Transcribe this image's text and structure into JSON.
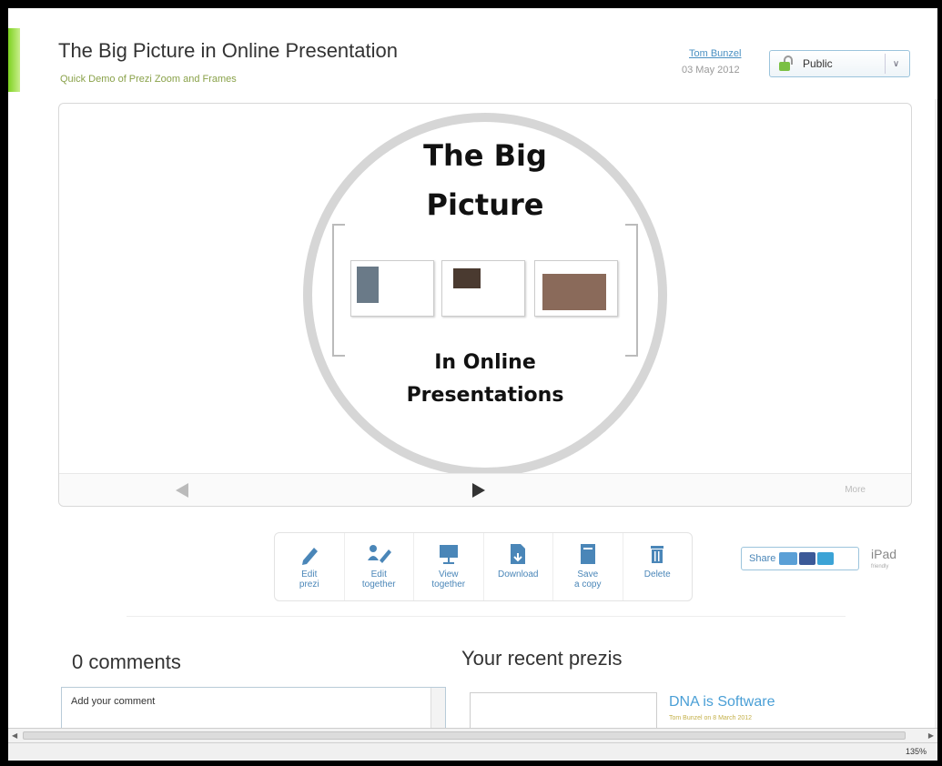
{
  "prezi": {
    "title": "The Big Picture in Online Presentation",
    "subtitle": "Quick Demo of Prezi Zoom and Frames",
    "author": "Tom Bunzel",
    "date": "03 May 2012",
    "privacy": "Public"
  },
  "canvas": {
    "title_line1": "The Big",
    "title_line2": "Picture",
    "sub_line1": "In Online",
    "sub_line2": "Presentations",
    "more_label": "More"
  },
  "toolbar": {
    "edit_prezi": "Edit\nprezi",
    "edit_together": "Edit\ntogether",
    "view_together": "View\ntogether",
    "download": "Download",
    "save_copy": "Save\na copy",
    "delete": "Delete"
  },
  "share": {
    "label": "Share",
    "ipad": "iPad",
    "ipad_sub": "friendly"
  },
  "comments": {
    "heading": "0 comments",
    "placeholder": "Add your comment"
  },
  "recent": {
    "heading": "Your recent prezis",
    "item_title": "DNA is Software",
    "item_meta": "Tom Bunzel on 8 March 2012"
  },
  "status": {
    "zoom": "135%"
  }
}
